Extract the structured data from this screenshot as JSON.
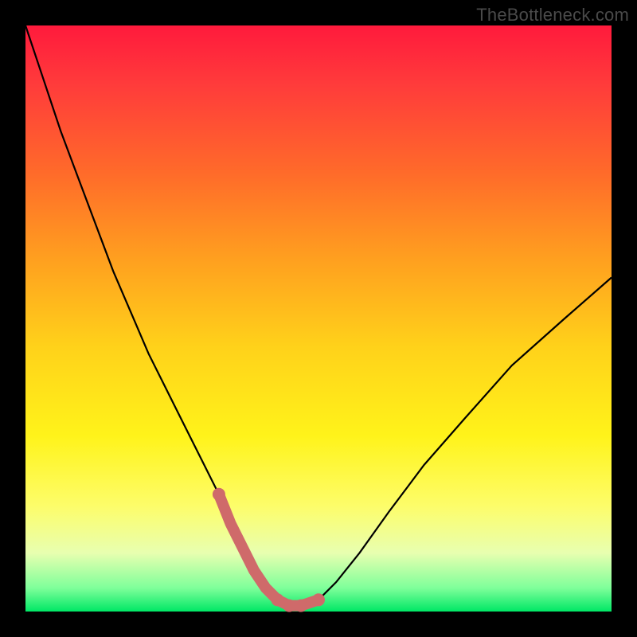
{
  "watermark": "TheBottleneck.com",
  "colors": {
    "frame_bg": "#000000",
    "gradient_top": "#ff1a3c",
    "gradient_bottom": "#00e765",
    "curve": "#000000",
    "highlight": "#cf6a6a"
  },
  "chart_data": {
    "type": "line",
    "title": "",
    "xlabel": "",
    "ylabel": "",
    "xlim": [
      0,
      100
    ],
    "ylim": [
      0,
      100
    ],
    "grid": false,
    "series": [
      {
        "name": "bottleneck-curve",
        "x": [
          0,
          3,
          6,
          9,
          12,
          15,
          18,
          21,
          24,
          27,
          30,
          33,
          35,
          37,
          39,
          41,
          43,
          45,
          47,
          50,
          53,
          57,
          62,
          68,
          75,
          83,
          92,
          100
        ],
        "values": [
          100,
          91,
          82,
          74,
          66,
          58,
          51,
          44,
          38,
          32,
          26,
          20,
          15,
          11,
          7,
          4,
          2,
          1,
          1,
          2,
          5,
          10,
          17,
          25,
          33,
          42,
          50,
          57
        ]
      }
    ],
    "highlight_region": {
      "x_start": 33,
      "x_end": 50
    },
    "annotations": []
  }
}
